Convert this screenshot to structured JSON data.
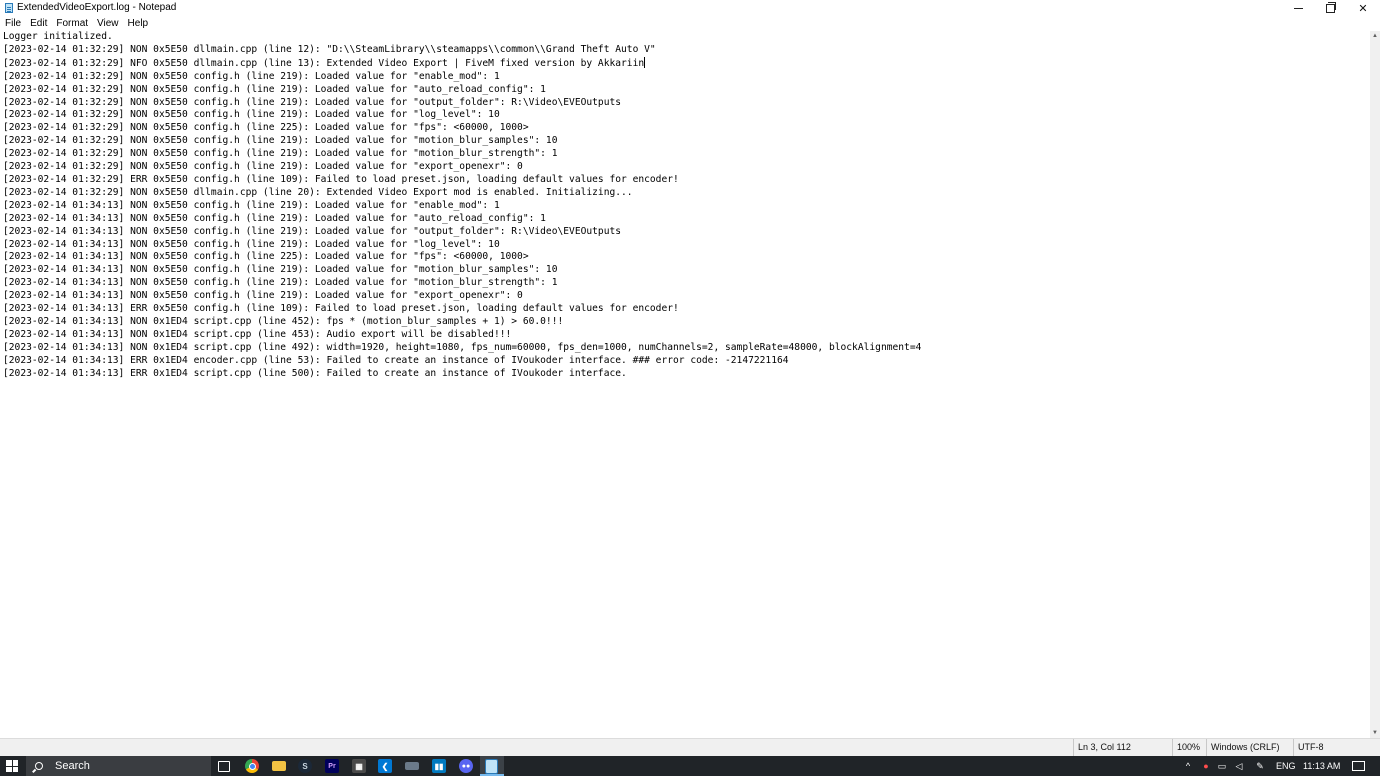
{
  "window": {
    "title": "ExtendedVideoExport.log - Notepad"
  },
  "menu": {
    "items": [
      "File",
      "Edit",
      "Format",
      "View",
      "Help"
    ]
  },
  "editor": {
    "lines": [
      "Logger initialized.",
      "[2023-02-14 01:32:29] NON 0x5E50 dllmain.cpp (line 12): \"D:\\\\SteamLibrary\\\\steamapps\\\\common\\\\Grand Theft Auto V\"",
      "[2023-02-14 01:32:29] NFO 0x5E50 dllmain.cpp (line 13): Extended Video Export | FiveM fixed version by Akkariin",
      "[2023-02-14 01:32:29] NON 0x5E50 config.h (line 219): Loaded value for \"enable_mod\": 1",
      "[2023-02-14 01:32:29] NON 0x5E50 config.h (line 219): Loaded value for \"auto_reload_config\": 1",
      "[2023-02-14 01:32:29] NON 0x5E50 config.h (line 219): Loaded value for \"output_folder\": R:\\Video\\EVEOutputs",
      "[2023-02-14 01:32:29] NON 0x5E50 config.h (line 219): Loaded value for \"log_level\": 10",
      "[2023-02-14 01:32:29] NON 0x5E50 config.h (line 225): Loaded value for \"fps\": <60000, 1000>",
      "[2023-02-14 01:32:29] NON 0x5E50 config.h (line 219): Loaded value for \"motion_blur_samples\": 10",
      "[2023-02-14 01:32:29] NON 0x5E50 config.h (line 219): Loaded value for \"motion_blur_strength\": 1",
      "[2023-02-14 01:32:29] NON 0x5E50 config.h (line 219): Loaded value for \"export_openexr\": 0",
      "[2023-02-14 01:32:29] ERR 0x5E50 config.h (line 109): Failed to load preset.json, loading default values for encoder!",
      "[2023-02-14 01:32:29] NON 0x5E50 dllmain.cpp (line 20): Extended Video Export mod is enabled. Initializing...",
      "[2023-02-14 01:34:13] NON 0x5E50 config.h (line 219): Loaded value for \"enable_mod\": 1",
      "[2023-02-14 01:34:13] NON 0x5E50 config.h (line 219): Loaded value for \"auto_reload_config\": 1",
      "[2023-02-14 01:34:13] NON 0x5E50 config.h (line 219): Loaded value for \"output_folder\": R:\\Video\\EVEOutputs",
      "[2023-02-14 01:34:13] NON 0x5E50 config.h (line 219): Loaded value for \"log_level\": 10",
      "[2023-02-14 01:34:13] NON 0x5E50 config.h (line 225): Loaded value for \"fps\": <60000, 1000>",
      "[2023-02-14 01:34:13] NON 0x5E50 config.h (line 219): Loaded value for \"motion_blur_samples\": 10",
      "[2023-02-14 01:34:13] NON 0x5E50 config.h (line 219): Loaded value for \"motion_blur_strength\": 1",
      "[2023-02-14 01:34:13] NON 0x5E50 config.h (line 219): Loaded value for \"export_openexr\": 0",
      "[2023-02-14 01:34:13] ERR 0x5E50 config.h (line 109): Failed to load preset.json, loading default values for encoder!",
      "[2023-02-14 01:34:13] NON 0x1ED4 script.cpp (line 452): fps * (motion_blur_samples + 1) > 60.0!!!",
      "[2023-02-14 01:34:13] NON 0x1ED4 script.cpp (line 453): Audio export will be disabled!!!",
      "[2023-02-14 01:34:13] NON 0x1ED4 script.cpp (line 492): width=1920, height=1080, fps_num=60000, fps_den=1000, numChannels=2, sampleRate=48000, blockAlignment=4",
      "[2023-02-14 01:34:13] ERR 0x1ED4 encoder.cpp (line 53): Failed to create an instance of IVoukoder interface. ### error code: -2147221164",
      "[2023-02-14 01:34:13] ERR 0x1ED4 script.cpp (line 500): Failed to create an instance of IVoukoder interface."
    ]
  },
  "status": {
    "position": "Ln 3, Col 112",
    "zoom": "100%",
    "line_ending": "Windows (CRLF)",
    "encoding": "UTF-8"
  },
  "taskbar": {
    "search_placeholder": "Search",
    "language": "ENG",
    "time": "11:13 AM",
    "icons": [
      "task-view-icon",
      "chrome-icon",
      "file-explorer-icon",
      "steam-icon",
      "premiere-pro-icon",
      "calculator-icon",
      "vscode-icon",
      "keyboard-icon",
      "trello-icon",
      "discord-icon",
      "notepad-icon"
    ]
  },
  "colors": {
    "taskbar_bg": "#202428",
    "active_indicator": "#76b9ed",
    "statusbar_bg": "#f0f0f0"
  }
}
